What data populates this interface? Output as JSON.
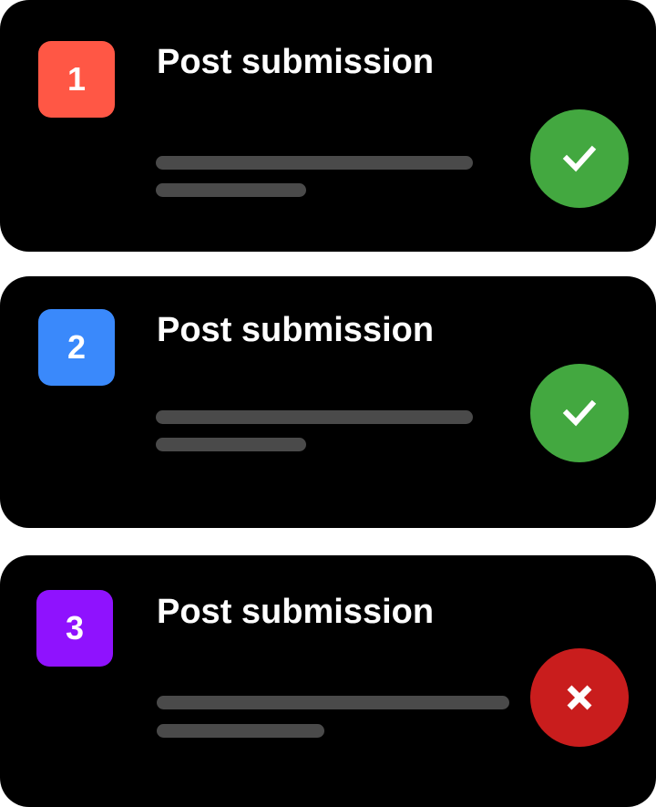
{
  "submissions": [
    {
      "number": "1",
      "title": "Post submission",
      "badge_color": "#ff5745",
      "status": "approved",
      "status_icon": "check-icon",
      "status_color": "#43a840"
    },
    {
      "number": "2",
      "title": "Post submission",
      "badge_color": "#3a89fb",
      "status": "approved",
      "status_icon": "check-icon",
      "status_color": "#43a840"
    },
    {
      "number": "3",
      "title": "Post submission",
      "badge_color": "#8f12fe",
      "status": "rejected",
      "status_icon": "close-icon",
      "status_color": "#c91d1d"
    }
  ]
}
